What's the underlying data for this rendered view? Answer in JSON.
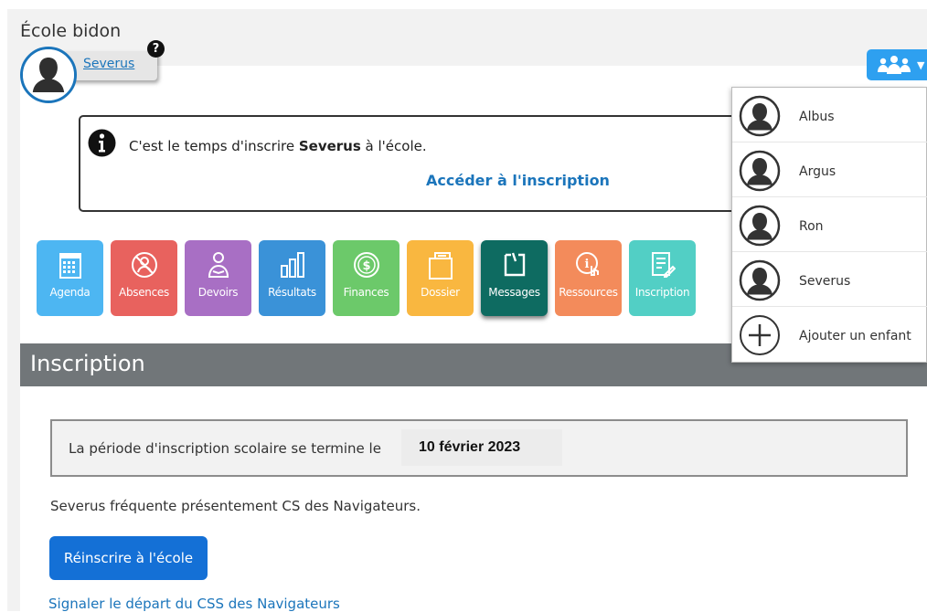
{
  "school": {
    "name": "École bidon"
  },
  "student": {
    "name": "Severus",
    "help": "?"
  },
  "notice": {
    "text_before": "C'est le temps d'inscrire ",
    "student": "Severus",
    "text_after": " à l'école.",
    "link": "Accéder à l'inscription"
  },
  "tiles": [
    {
      "label": "Agenda",
      "icon": "calendar-icon",
      "color": "#4db6f2"
    },
    {
      "label": "Absences",
      "icon": "absences-icon",
      "color": "#e8625e"
    },
    {
      "label": "Devoirs",
      "icon": "homework-icon",
      "color": "#a86fc4"
    },
    {
      "label": "Résultats",
      "icon": "bar-chart-icon",
      "color": "#3a92d8"
    },
    {
      "label": "Finances",
      "icon": "dollar-icon",
      "color": "#6cc96a"
    },
    {
      "label": "Dossier",
      "icon": "folder-icon",
      "color": "#f9b740"
    },
    {
      "label": "Messages",
      "icon": "note-icon",
      "color": "#0e6b61"
    },
    {
      "label": "Ressources",
      "icon": "resources-icon",
      "color": "#f38b5b"
    },
    {
      "label": "Inscription",
      "icon": "form-icon",
      "color": "#52cfc5"
    }
  ],
  "section": {
    "title": "Inscription"
  },
  "period": {
    "text": "La période d'inscription scolaire se termine le",
    "date": "10 février 2023"
  },
  "attendance": {
    "text": "Severus fréquente présentement CS des Navigateurs."
  },
  "actions": {
    "reenroll": "Réinscrire à l'école",
    "departure": "Signaler le départ du CSS des Navigateurs"
  },
  "children_menu": {
    "button_icon": "family-icon",
    "items": [
      {
        "label": "Albus"
      },
      {
        "label": "Argus"
      },
      {
        "label": "Ron"
      },
      {
        "label": "Severus"
      },
      {
        "label": "Ajouter un enfant"
      }
    ]
  }
}
